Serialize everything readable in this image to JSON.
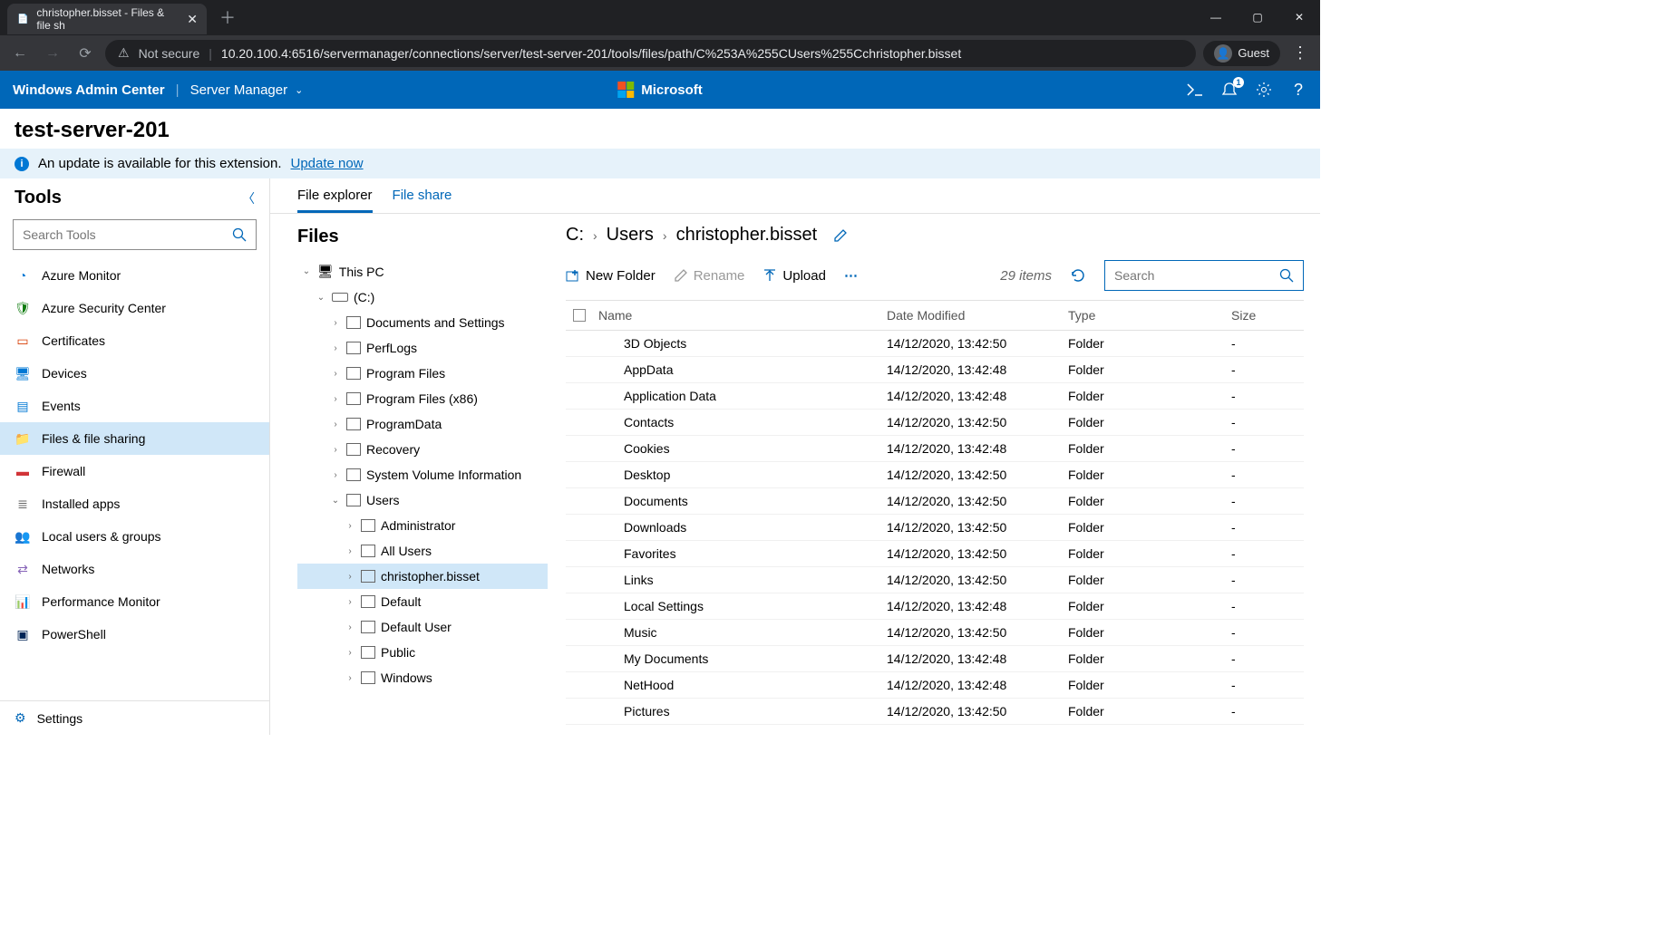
{
  "browser": {
    "tab_title": "christopher.bisset - Files & file sh",
    "not_secure": "Not secure",
    "url": "10.20.100.4:6516/servermanager/connections/server/test-server-201/tools/files/path/C%253A%255CUsers%255Cchristopher.bisset",
    "guest": "Guest"
  },
  "header": {
    "brand": "Windows Admin Center",
    "context": "Server Manager",
    "microsoft": "Microsoft",
    "notif_count": "1"
  },
  "page_title": "test-server-201",
  "banner": {
    "text": "An update is available for this extension.",
    "link": "Update now"
  },
  "tools": {
    "title": "Tools",
    "search_placeholder": "Search Tools",
    "items": [
      {
        "label": "Azure Monitor",
        "color": "#0078d4",
        "glyph": "◔"
      },
      {
        "label": "Azure Security Center",
        "color": "#107c10",
        "glyph": "🛡"
      },
      {
        "label": "Certificates",
        "color": "#d83b01",
        "glyph": "▭"
      },
      {
        "label": "Devices",
        "color": "#0078d4",
        "glyph": "🖥"
      },
      {
        "label": "Events",
        "color": "#0078d4",
        "glyph": "▤"
      },
      {
        "label": "Files & file sharing",
        "color": "#ffb900",
        "glyph": "📁"
      },
      {
        "label": "Firewall",
        "color": "#d13438",
        "glyph": "▬"
      },
      {
        "label": "Installed apps",
        "color": "#666",
        "glyph": "≣"
      },
      {
        "label": "Local users & groups",
        "color": "#0078d4",
        "glyph": "👥"
      },
      {
        "label": "Networks",
        "color": "#8764b8",
        "glyph": "⇄"
      },
      {
        "label": "Performance Monitor",
        "color": "#0078d4",
        "glyph": "📊"
      },
      {
        "label": "PowerShell",
        "color": "#012456",
        "glyph": "▣"
      }
    ],
    "active_index": 5,
    "settings": "Settings"
  },
  "file_tabs": {
    "active": "File explorer",
    "inactive": "File share"
  },
  "tree": {
    "title": "Files",
    "nodes": [
      {
        "indent": 1,
        "label": "This PC",
        "expanded": true,
        "icon": "pc"
      },
      {
        "indent": 2,
        "label": "(C:)",
        "expanded": true,
        "icon": "drive"
      },
      {
        "indent": 3,
        "label": "Documents and Settings",
        "expanded": false
      },
      {
        "indent": 3,
        "label": "PerfLogs",
        "expanded": false
      },
      {
        "indent": 3,
        "label": "Program Files",
        "expanded": false
      },
      {
        "indent": 3,
        "label": "Program Files (x86)",
        "expanded": false
      },
      {
        "indent": 3,
        "label": "ProgramData",
        "expanded": false
      },
      {
        "indent": 3,
        "label": "Recovery",
        "expanded": false
      },
      {
        "indent": 3,
        "label": "System Volume Information",
        "expanded": false
      },
      {
        "indent": 3,
        "label": "Users",
        "expanded": true
      },
      {
        "indent": 4,
        "label": "Administrator",
        "expanded": false
      },
      {
        "indent": 4,
        "label": "All Users",
        "expanded": false
      },
      {
        "indent": 4,
        "label": "christopher.bisset",
        "expanded": false,
        "selected": true
      },
      {
        "indent": 4,
        "label": "Default",
        "expanded": false
      },
      {
        "indent": 4,
        "label": "Default User",
        "expanded": false
      },
      {
        "indent": 4,
        "label": "Public",
        "expanded": false
      },
      {
        "indent": 4,
        "label": "Windows",
        "expanded": false
      }
    ]
  },
  "breadcrumb": [
    "C:",
    "Users",
    "christopher.bisset"
  ],
  "toolbar": {
    "new_folder": "New Folder",
    "rename": "Rename",
    "upload": "Upload",
    "item_count": "29 items",
    "search_placeholder": "Search"
  },
  "columns": {
    "name": "Name",
    "date": "Date Modified",
    "type": "Type",
    "size": "Size"
  },
  "rows": [
    {
      "name": "3D Objects",
      "date": "14/12/2020, 13:42:50",
      "type": "Folder",
      "size": "-"
    },
    {
      "name": "AppData",
      "date": "14/12/2020, 13:42:48",
      "type": "Folder",
      "size": "-"
    },
    {
      "name": "Application Data",
      "date": "14/12/2020, 13:42:48",
      "type": "Folder",
      "size": "-"
    },
    {
      "name": "Contacts",
      "date": "14/12/2020, 13:42:50",
      "type": "Folder",
      "size": "-"
    },
    {
      "name": "Cookies",
      "date": "14/12/2020, 13:42:48",
      "type": "Folder",
      "size": "-"
    },
    {
      "name": "Desktop",
      "date": "14/12/2020, 13:42:50",
      "type": "Folder",
      "size": "-"
    },
    {
      "name": "Documents",
      "date": "14/12/2020, 13:42:50",
      "type": "Folder",
      "size": "-"
    },
    {
      "name": "Downloads",
      "date": "14/12/2020, 13:42:50",
      "type": "Folder",
      "size": "-"
    },
    {
      "name": "Favorites",
      "date": "14/12/2020, 13:42:50",
      "type": "Folder",
      "size": "-"
    },
    {
      "name": "Links",
      "date": "14/12/2020, 13:42:50",
      "type": "Folder",
      "size": "-"
    },
    {
      "name": "Local Settings",
      "date": "14/12/2020, 13:42:48",
      "type": "Folder",
      "size": "-"
    },
    {
      "name": "Music",
      "date": "14/12/2020, 13:42:50",
      "type": "Folder",
      "size": "-"
    },
    {
      "name": "My Documents",
      "date": "14/12/2020, 13:42:48",
      "type": "Folder",
      "size": "-"
    },
    {
      "name": "NetHood",
      "date": "14/12/2020, 13:42:48",
      "type": "Folder",
      "size": "-"
    },
    {
      "name": "Pictures",
      "date": "14/12/2020, 13:42:50",
      "type": "Folder",
      "size": "-"
    }
  ]
}
